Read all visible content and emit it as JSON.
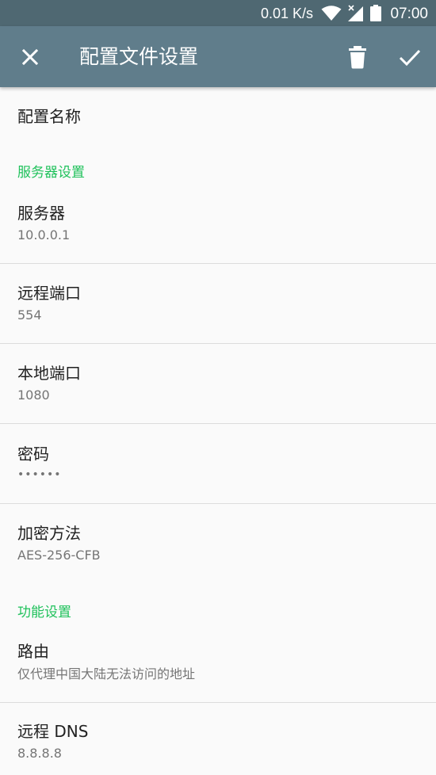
{
  "status_bar": {
    "net_speed": "0.01 K/s",
    "time": "07:00",
    "icons": [
      "wifi-icon",
      "cell-signal-icon",
      "battery-icon"
    ]
  },
  "toolbar": {
    "title": "配置文件设置",
    "icons": [
      "close-icon",
      "delete-icon",
      "check-icon"
    ],
    "background": "#607d8b"
  },
  "colors": {
    "accent": "#1fc15b",
    "status_bar": "#4f6872"
  },
  "prefs": {
    "profile_name": {
      "title": "配置名称"
    },
    "server_category": "服务器设置",
    "server": {
      "title": "服务器",
      "summary": "10.0.0.1"
    },
    "remote_port": {
      "title": "远程端口",
      "summary": "554"
    },
    "local_port": {
      "title": "本地端口",
      "summary": "1080"
    },
    "password": {
      "title": "密码",
      "summary": "••••••"
    },
    "encrypt": {
      "title": "加密方法",
      "summary": "AES-256-CFB"
    },
    "feature_category": "功能设置",
    "route": {
      "title": "路由",
      "summary": "仅代理中国大陆无法访问的地址"
    },
    "remote_dns": {
      "title": "远程 DNS",
      "summary": "8.8.8.8"
    }
  }
}
